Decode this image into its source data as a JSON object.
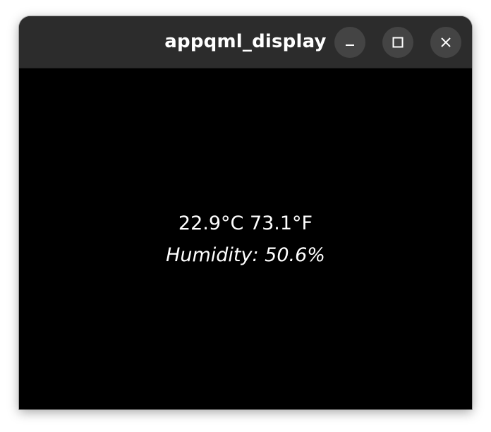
{
  "window": {
    "title": "appqml_display",
    "buttons": {
      "minimize_icon": "minimize-icon",
      "maximize_icon": "maximize-icon",
      "close_icon": "close-icon"
    }
  },
  "readings": {
    "temperature": "22.9°C  73.1°F",
    "humidity": "Humidity: 50.6%"
  },
  "colors": {
    "titlebar": "#2c2c2c",
    "button": "#444444",
    "background": "#000000",
    "text": "#ffffff"
  }
}
